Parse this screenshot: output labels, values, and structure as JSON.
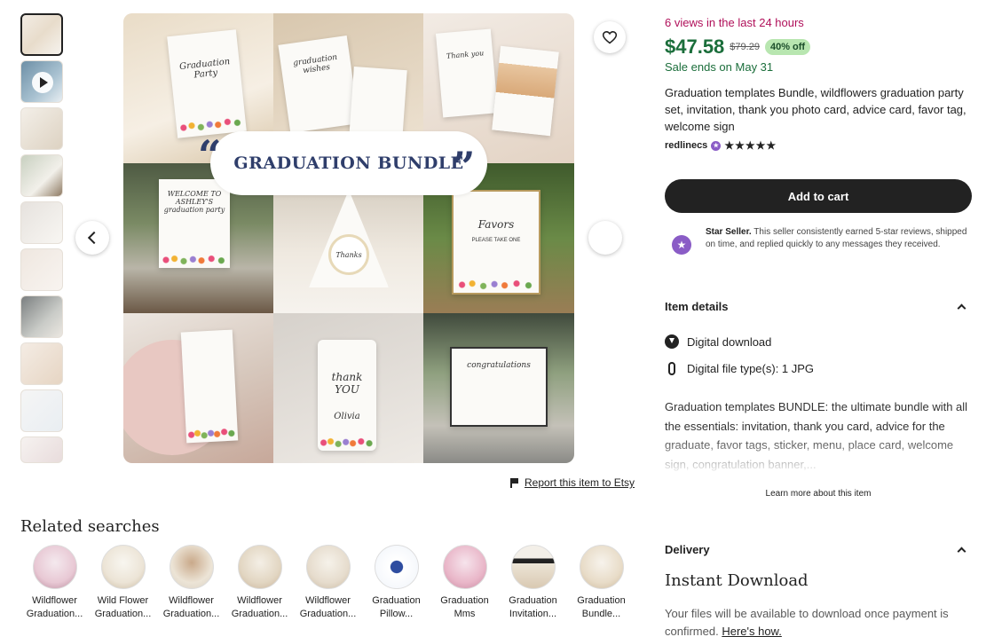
{
  "gallery": {
    "main_image_banner": "GRADUATION BUNDLE",
    "card_texts": [
      "Graduation Party",
      "graduation wishes",
      "Thank you",
      "WELCOME TO ASHLEY'S graduation party",
      "Thanks",
      "Favors",
      "PLEASE TAKE ONE",
      "thank YOU",
      "Olivia",
      "congratulations"
    ],
    "prev_label": "Previous image",
    "next_label": "Next image",
    "favorite_icon": "heart-icon"
  },
  "report": {
    "label": "Report this item to Etsy"
  },
  "related": {
    "title": "Related searches",
    "items": [
      {
        "line1": "Wildflower",
        "line2": "Graduation..."
      },
      {
        "line1": "Wild Flower",
        "line2": "Graduation..."
      },
      {
        "line1": "Wildflower",
        "line2": "Graduation..."
      },
      {
        "line1": "Wildflower",
        "line2": "Graduation..."
      },
      {
        "line1": "Wildflower",
        "line2": "Graduation..."
      },
      {
        "line1": "Graduation",
        "line2": "Pillow..."
      },
      {
        "line1": "Graduation",
        "line2": "Mms"
      },
      {
        "line1": "Graduation",
        "line2": "Invitation..."
      },
      {
        "line1": "Graduation",
        "line2": "Bundle..."
      }
    ]
  },
  "listing": {
    "views": "6 views in the last 24 hours",
    "price": "$47.58",
    "old_price": "$79.29",
    "discount": "40% off",
    "sale_ends": "Sale ends on May 31",
    "title": "Graduation templates Bundle, wildflowers graduation party set, invitation, thank you photo card, advice card, favor tag, welcome sign",
    "shop_name": "redlinecs",
    "stars": "★★★★★",
    "add_to_cart": "Add to cart",
    "star_seller_label": "Star Seller.",
    "star_seller_text": " This seller consistently earned 5-star reviews, shipped on time, and replied quickly to any messages they received.",
    "item_details_heading": "Item details",
    "digital_download": "Digital download",
    "file_types": "Digital file type(s): 1 JPG",
    "description": "Graduation templates BUNDLE: the ultimate bundle with all the essentials: invitation, thank you card, advice for the graduate, favor tags, sticker, menu, place card, welcome sign, congratulation banner,...",
    "learn_more": "Learn more about this item",
    "delivery_heading": "Delivery",
    "instant_download": "Instant Download",
    "files_text": "Your files will be available to download once payment is confirmed.",
    "heres_how": "Here's how."
  },
  "colors": {
    "views": "#b0105a",
    "price": "#1b6e3b",
    "banner_text": "#2f3e6b",
    "star_seller": "#8a5cc6"
  }
}
